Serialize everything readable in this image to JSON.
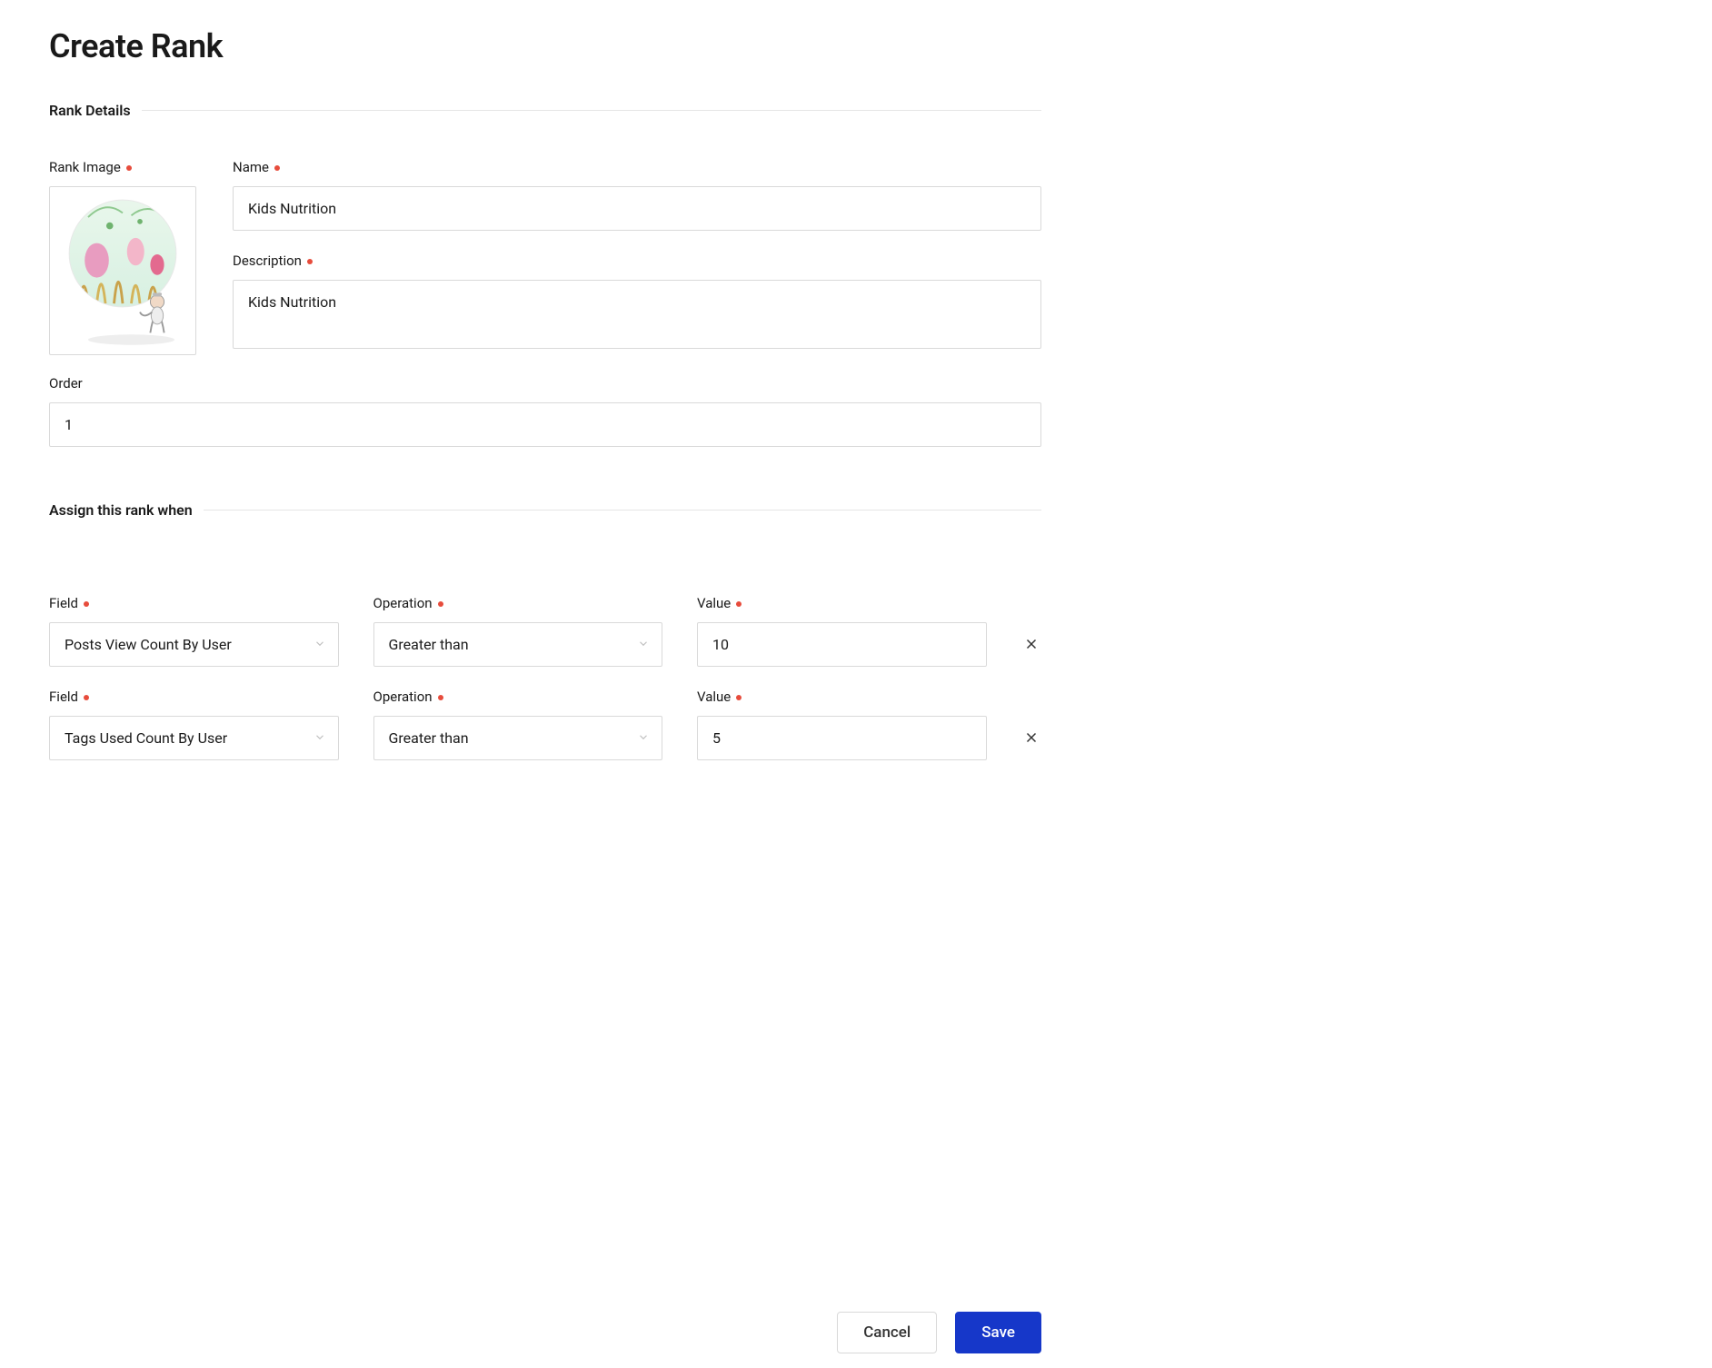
{
  "pageTitle": "Create Rank",
  "sections": {
    "details": "Rank Details",
    "assign": "Assign this rank when"
  },
  "labels": {
    "rankImage": "Rank Image",
    "name": "Name",
    "description": "Description",
    "order": "Order",
    "field": "Field",
    "operation": "Operation",
    "value": "Value"
  },
  "values": {
    "name": "Kids Nutrition",
    "description": "Kids Nutrition",
    "order": "1"
  },
  "rules": [
    {
      "field": "Posts View Count By User",
      "operation": "Greater than",
      "value": "10"
    },
    {
      "field": "Tags Used Count By User",
      "operation": "Greater than",
      "value": "5"
    }
  ],
  "footer": {
    "cancel": "Cancel",
    "save": "Save"
  }
}
